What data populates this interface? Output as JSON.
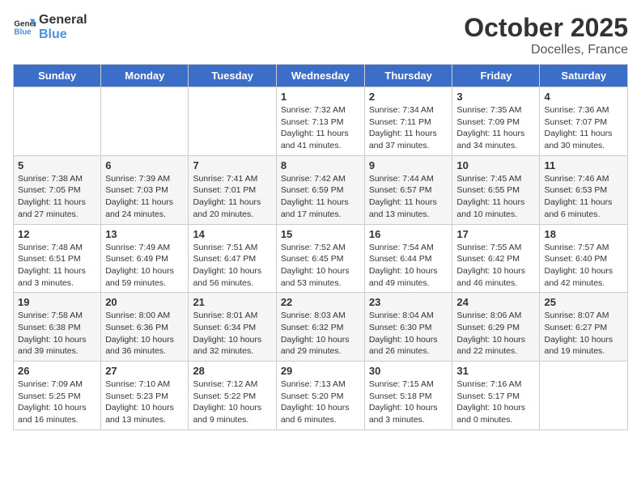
{
  "header": {
    "logo_general": "General",
    "logo_blue": "Blue",
    "month": "October 2025",
    "location": "Docelles, France"
  },
  "days_of_week": [
    "Sunday",
    "Monday",
    "Tuesday",
    "Wednesday",
    "Thursday",
    "Friday",
    "Saturday"
  ],
  "weeks": [
    [
      {
        "day": "",
        "info": ""
      },
      {
        "day": "",
        "info": ""
      },
      {
        "day": "",
        "info": ""
      },
      {
        "day": "1",
        "info": "Sunrise: 7:32 AM\nSunset: 7:13 PM\nDaylight: 11 hours and 41 minutes."
      },
      {
        "day": "2",
        "info": "Sunrise: 7:34 AM\nSunset: 7:11 PM\nDaylight: 11 hours and 37 minutes."
      },
      {
        "day": "3",
        "info": "Sunrise: 7:35 AM\nSunset: 7:09 PM\nDaylight: 11 hours and 34 minutes."
      },
      {
        "day": "4",
        "info": "Sunrise: 7:36 AM\nSunset: 7:07 PM\nDaylight: 11 hours and 30 minutes."
      }
    ],
    [
      {
        "day": "5",
        "info": "Sunrise: 7:38 AM\nSunset: 7:05 PM\nDaylight: 11 hours and 27 minutes."
      },
      {
        "day": "6",
        "info": "Sunrise: 7:39 AM\nSunset: 7:03 PM\nDaylight: 11 hours and 24 minutes."
      },
      {
        "day": "7",
        "info": "Sunrise: 7:41 AM\nSunset: 7:01 PM\nDaylight: 11 hours and 20 minutes."
      },
      {
        "day": "8",
        "info": "Sunrise: 7:42 AM\nSunset: 6:59 PM\nDaylight: 11 hours and 17 minutes."
      },
      {
        "day": "9",
        "info": "Sunrise: 7:44 AM\nSunset: 6:57 PM\nDaylight: 11 hours and 13 minutes."
      },
      {
        "day": "10",
        "info": "Sunrise: 7:45 AM\nSunset: 6:55 PM\nDaylight: 11 hours and 10 minutes."
      },
      {
        "day": "11",
        "info": "Sunrise: 7:46 AM\nSunset: 6:53 PM\nDaylight: 11 hours and 6 minutes."
      }
    ],
    [
      {
        "day": "12",
        "info": "Sunrise: 7:48 AM\nSunset: 6:51 PM\nDaylight: 11 hours and 3 minutes."
      },
      {
        "day": "13",
        "info": "Sunrise: 7:49 AM\nSunset: 6:49 PM\nDaylight: 10 hours and 59 minutes."
      },
      {
        "day": "14",
        "info": "Sunrise: 7:51 AM\nSunset: 6:47 PM\nDaylight: 10 hours and 56 minutes."
      },
      {
        "day": "15",
        "info": "Sunrise: 7:52 AM\nSunset: 6:45 PM\nDaylight: 10 hours and 53 minutes."
      },
      {
        "day": "16",
        "info": "Sunrise: 7:54 AM\nSunset: 6:44 PM\nDaylight: 10 hours and 49 minutes."
      },
      {
        "day": "17",
        "info": "Sunrise: 7:55 AM\nSunset: 6:42 PM\nDaylight: 10 hours and 46 minutes."
      },
      {
        "day": "18",
        "info": "Sunrise: 7:57 AM\nSunset: 6:40 PM\nDaylight: 10 hours and 42 minutes."
      }
    ],
    [
      {
        "day": "19",
        "info": "Sunrise: 7:58 AM\nSunset: 6:38 PM\nDaylight: 10 hours and 39 minutes."
      },
      {
        "day": "20",
        "info": "Sunrise: 8:00 AM\nSunset: 6:36 PM\nDaylight: 10 hours and 36 minutes."
      },
      {
        "day": "21",
        "info": "Sunrise: 8:01 AM\nSunset: 6:34 PM\nDaylight: 10 hours and 32 minutes."
      },
      {
        "day": "22",
        "info": "Sunrise: 8:03 AM\nSunset: 6:32 PM\nDaylight: 10 hours and 29 minutes."
      },
      {
        "day": "23",
        "info": "Sunrise: 8:04 AM\nSunset: 6:30 PM\nDaylight: 10 hours and 26 minutes."
      },
      {
        "day": "24",
        "info": "Sunrise: 8:06 AM\nSunset: 6:29 PM\nDaylight: 10 hours and 22 minutes."
      },
      {
        "day": "25",
        "info": "Sunrise: 8:07 AM\nSunset: 6:27 PM\nDaylight: 10 hours and 19 minutes."
      }
    ],
    [
      {
        "day": "26",
        "info": "Sunrise: 7:09 AM\nSunset: 5:25 PM\nDaylight: 10 hours and 16 minutes."
      },
      {
        "day": "27",
        "info": "Sunrise: 7:10 AM\nSunset: 5:23 PM\nDaylight: 10 hours and 13 minutes."
      },
      {
        "day": "28",
        "info": "Sunrise: 7:12 AM\nSunset: 5:22 PM\nDaylight: 10 hours and 9 minutes."
      },
      {
        "day": "29",
        "info": "Sunrise: 7:13 AM\nSunset: 5:20 PM\nDaylight: 10 hours and 6 minutes."
      },
      {
        "day": "30",
        "info": "Sunrise: 7:15 AM\nSunset: 5:18 PM\nDaylight: 10 hours and 3 minutes."
      },
      {
        "day": "31",
        "info": "Sunrise: 7:16 AM\nSunset: 5:17 PM\nDaylight: 10 hours and 0 minutes."
      },
      {
        "day": "",
        "info": ""
      }
    ]
  ]
}
